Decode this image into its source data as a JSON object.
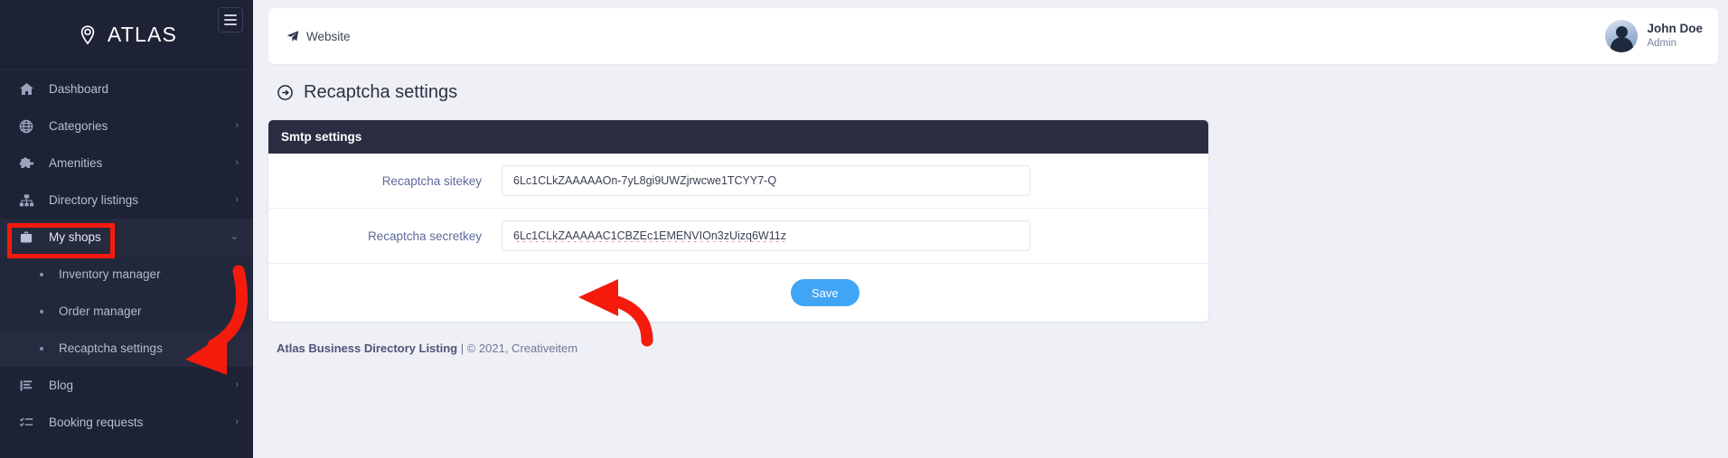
{
  "sidebar": {
    "brand": "ATLAS",
    "brand_icon": "map-pin-icon",
    "menu_toggle_icon": "hamburger-icon",
    "items": [
      {
        "label": "Dashboard",
        "icon": "home-icon",
        "caret": "",
        "active": false
      },
      {
        "label": "Categories",
        "icon": "globe-icon",
        "caret": "›",
        "active": false
      },
      {
        "label": "Amenities",
        "icon": "puzzle-icon",
        "caret": "›",
        "active": false
      },
      {
        "label": "Directory listings",
        "icon": "sitemap-icon",
        "caret": "›",
        "active": false
      },
      {
        "label": "My shops",
        "icon": "briefcase-icon",
        "caret": "⌄",
        "active": true
      },
      {
        "label": "Blog",
        "icon": "article-icon",
        "caret": "›",
        "active": false
      },
      {
        "label": "Booking requests",
        "icon": "tasklist-icon",
        "caret": "›",
        "active": false
      }
    ],
    "submenu": [
      {
        "label": "Inventory manager",
        "current": false
      },
      {
        "label": "Order manager",
        "current": false
      },
      {
        "label": "Recaptcha settings",
        "current": true
      }
    ]
  },
  "topbar": {
    "breadcrumb": "Website",
    "breadcrumb_icon": "paper-plane-icon",
    "user_name": "John Doe",
    "user_role": "Admin",
    "avatar_icon": "user-avatar"
  },
  "page": {
    "title": "Recaptcha settings",
    "title_icon": "arrow-circle-right-icon"
  },
  "card": {
    "header": "Smtp settings",
    "fields": [
      {
        "label": "Recaptcha sitekey",
        "value": "6Lc1CLkZAAAAAOn-7yL8gi9UWZjrwcwe1TCYY7-Q",
        "spellcheck_underline": false
      },
      {
        "label": "Recaptcha secretkey",
        "value": "6Lc1CLkZAAAAAC1CBZEc1EMENVIOn3zUizq6W11z",
        "spellcheck_underline": true
      }
    ],
    "save_label": "Save"
  },
  "footer": {
    "brand": "Atlas Business Directory Listing",
    "rest": " | © 2021, Creativeitem"
  },
  "annotations": {
    "highlight_target": "My shops",
    "arrow_target": "Recaptcha settings",
    "arrow_target_2": "Save",
    "color": "#f41b0d"
  }
}
